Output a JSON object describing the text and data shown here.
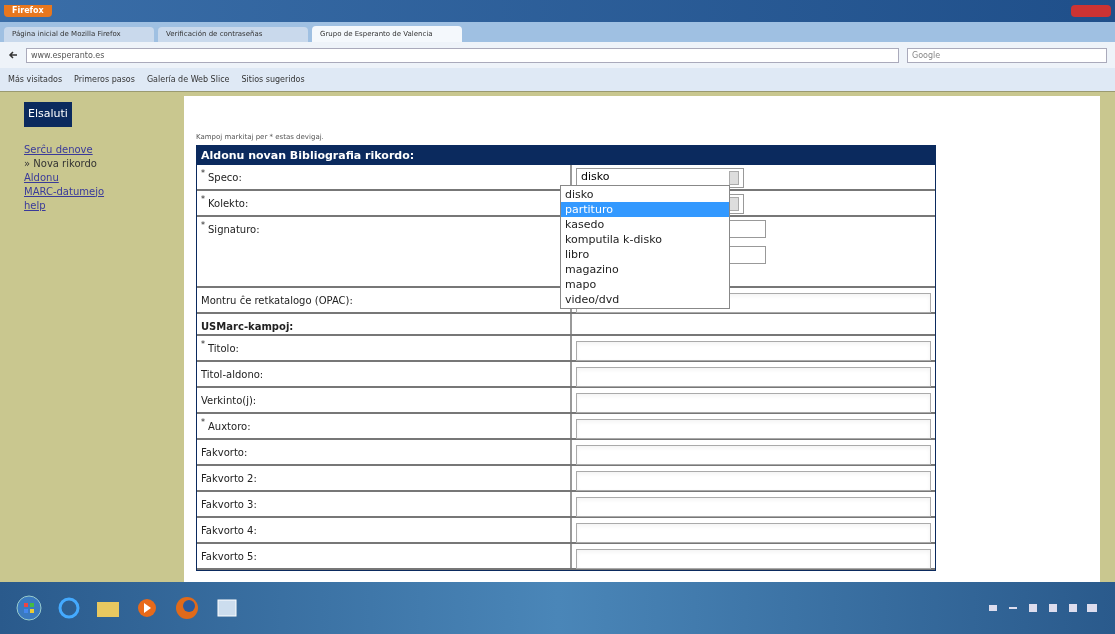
{
  "browser": {
    "menu_button": "Firefox",
    "tabs": [
      {
        "label": "Página inicial de Mozilla Firefox",
        "selected": false
      },
      {
        "label": "Verificación de contraseñas",
        "selected": false
      },
      {
        "label": "Grupo de Esperanto de Valencia",
        "selected": true
      }
    ],
    "address": "www.esperanto.es",
    "search_placeholder": "Google",
    "bookmarks": [
      "Más visitados",
      "Primeros pasos",
      "Galería de Web Slice",
      "Sitios sugeridos"
    ]
  },
  "sidebar": {
    "logout_button": "Elsaluti",
    "links": [
      {
        "label": "Serĉu denove",
        "kind": "link"
      },
      {
        "label": "» Nova rikordo",
        "kind": "current"
      },
      {
        "label": "Aldonu",
        "kind": "link"
      },
      {
        "label": "MARC-datumejo",
        "kind": "link"
      },
      {
        "label": "help",
        "kind": "link"
      }
    ]
  },
  "form": {
    "note": "Kampoj markitaj per * estas devigaj.",
    "title": "Aldonu novan Bibliografia rikordo:",
    "rows": [
      {
        "marker": "*",
        "label": "Speco:",
        "kind": "select",
        "value": "disko"
      },
      {
        "marker": "*",
        "label": "Kolekto:",
        "kind": "select"
      },
      {
        "marker": "*",
        "label": "Signaturo:",
        "kind": "multi"
      },
      {
        "label": "Montru ĉe retkatalogo (OPAC):",
        "kind": "text"
      },
      {
        "label": "USMarc-kampoj:",
        "kind": "section"
      },
      {
        "marker": "*",
        "label": "Titolo:",
        "kind": "text"
      },
      {
        "label": "Titol-aldono:",
        "kind": "text"
      },
      {
        "label": "Verkinto(j):",
        "kind": "text"
      },
      {
        "marker": "*",
        "label": "Auxtoro:",
        "kind": "text"
      },
      {
        "label": "Fakvorto:",
        "kind": "text"
      },
      {
        "label": "Fakvorto 2:",
        "kind": "text"
      },
      {
        "label": "Fakvorto 3:",
        "kind": "text"
      },
      {
        "label": "Fakvorto 4:",
        "kind": "text"
      },
      {
        "label": "Fakvorto 5:",
        "kind": "text"
      }
    ],
    "dropdown": [
      {
        "label": "disko",
        "selected": false
      },
      {
        "label": "partituro",
        "selected": true
      },
      {
        "label": "kasedo",
        "selected": false
      },
      {
        "label": "komputila k-disko",
        "selected": false
      },
      {
        "label": "libro",
        "selected": false
      },
      {
        "label": "magazino",
        "selected": false
      },
      {
        "label": "mapo",
        "selected": false
      },
      {
        "label": "video/dvd",
        "selected": false
      }
    ]
  }
}
